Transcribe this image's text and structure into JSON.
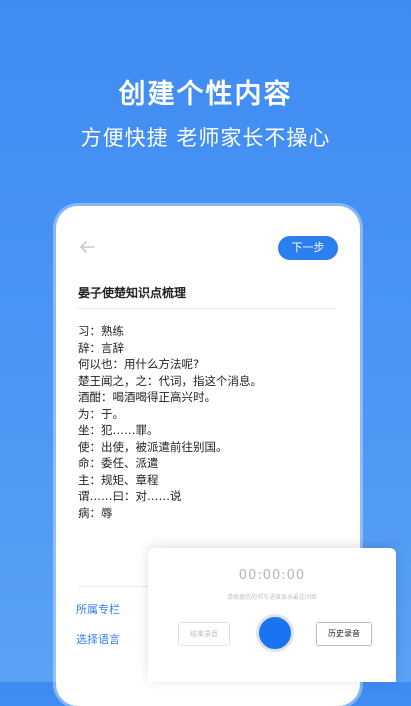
{
  "promo": {
    "headline": "创建个性内容",
    "subline": "方便快捷 老师家长不操心"
  },
  "editor": {
    "next_label": "下一步",
    "doc_title": "晏子使楚知识点梳理",
    "lines": [
      "习：熟练",
      "辞：言辞",
      "何以也：用什么方法呢?",
      "楚王闻之，之：代词，指这个消息。",
      "酒酣：喝酒喝得正高兴时。",
      "为：于。",
      "坐：犯……罪。",
      "使：出使，被派遣前往别国。",
      "命：委任、派遣",
      "主：规矩、章程",
      "谓……曰：对……说",
      "病：辱"
    ],
    "column_label": "所属专栏",
    "language_label": "选择语言"
  },
  "recorder": {
    "timer": "00:00:00",
    "hint": "请根据您的书写进度录出最佳间距",
    "end_label": "结束录音",
    "history_label": "历史录音"
  },
  "colors": {
    "accent": "#2b7ff0",
    "background": "#4b96f4",
    "record_button": "#1a73f0"
  }
}
